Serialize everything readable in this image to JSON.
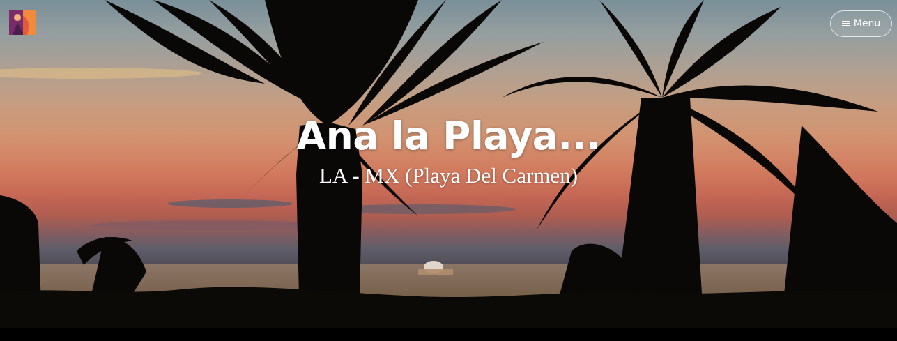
{
  "site": {
    "title": "Ana la Playa...",
    "description": "LA - MX (Playa Del Carmen)"
  },
  "header": {
    "menu_label": "Menu",
    "menu_icon": "hamburger-icon",
    "logo_icon": "site-logo-icon"
  },
  "colors": {
    "sky_top": "#8aa3ad",
    "sunset_orange": "#f08d6c",
    "sun": "#fff4e6",
    "silhouette": "#0c0a08",
    "bottom_bar": "#000000"
  }
}
